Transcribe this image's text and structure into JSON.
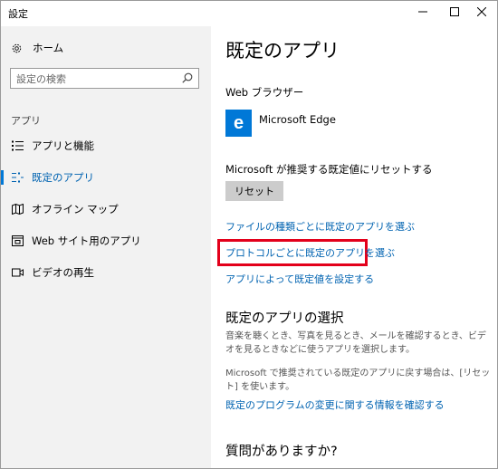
{
  "window": {
    "title": "設定"
  },
  "sidebar": {
    "home_label": "ホーム",
    "search_placeholder": "設定の検索",
    "section_label": "アプリ",
    "items": [
      {
        "label": "アプリと機能",
        "icon": "apps-features-icon",
        "active": false
      },
      {
        "label": "既定のアプリ",
        "icon": "default-apps-icon",
        "active": true
      },
      {
        "label": "オフライン マップ",
        "icon": "offline-maps-icon",
        "active": false
      },
      {
        "label": "Web サイト用のアプリ",
        "icon": "apps-for-websites-icon",
        "active": false
      },
      {
        "label": "ビデオの再生",
        "icon": "video-playback-icon",
        "active": false
      }
    ]
  },
  "main": {
    "title": "既定のアプリ",
    "web_browser_label": "Web ブラウザー",
    "web_browser_app": "Microsoft Edge",
    "reset_label": "Microsoft が推奨する既定値にリセットする",
    "reset_button": "リセット",
    "links": {
      "by_file_type": "ファイルの種類ごとに既定のアプリを選ぶ",
      "by_protocol": "プロトコルごとに既定のアプリを選ぶ",
      "by_app": "アプリによって既定値を設定する"
    },
    "choose_heading": "既定のアプリの選択",
    "choose_desc": "音楽を聴くとき、写真を見るとき、メールを確認するとき、ビデオを見るときなどに使うアプリを選択します。",
    "reset_desc": "Microsoft で推奨されている既定のアプリに戻す場合は、[リセット] を使います。",
    "more_info_link": "既定のプログラムの変更に関する情報を確認する",
    "help_heading": "質問がありますか?"
  },
  "colors": {
    "accent": "#0078d7",
    "link": "#0063b1",
    "highlight": "#e3001b",
    "sidebar_bg": "#f2f2f2"
  }
}
